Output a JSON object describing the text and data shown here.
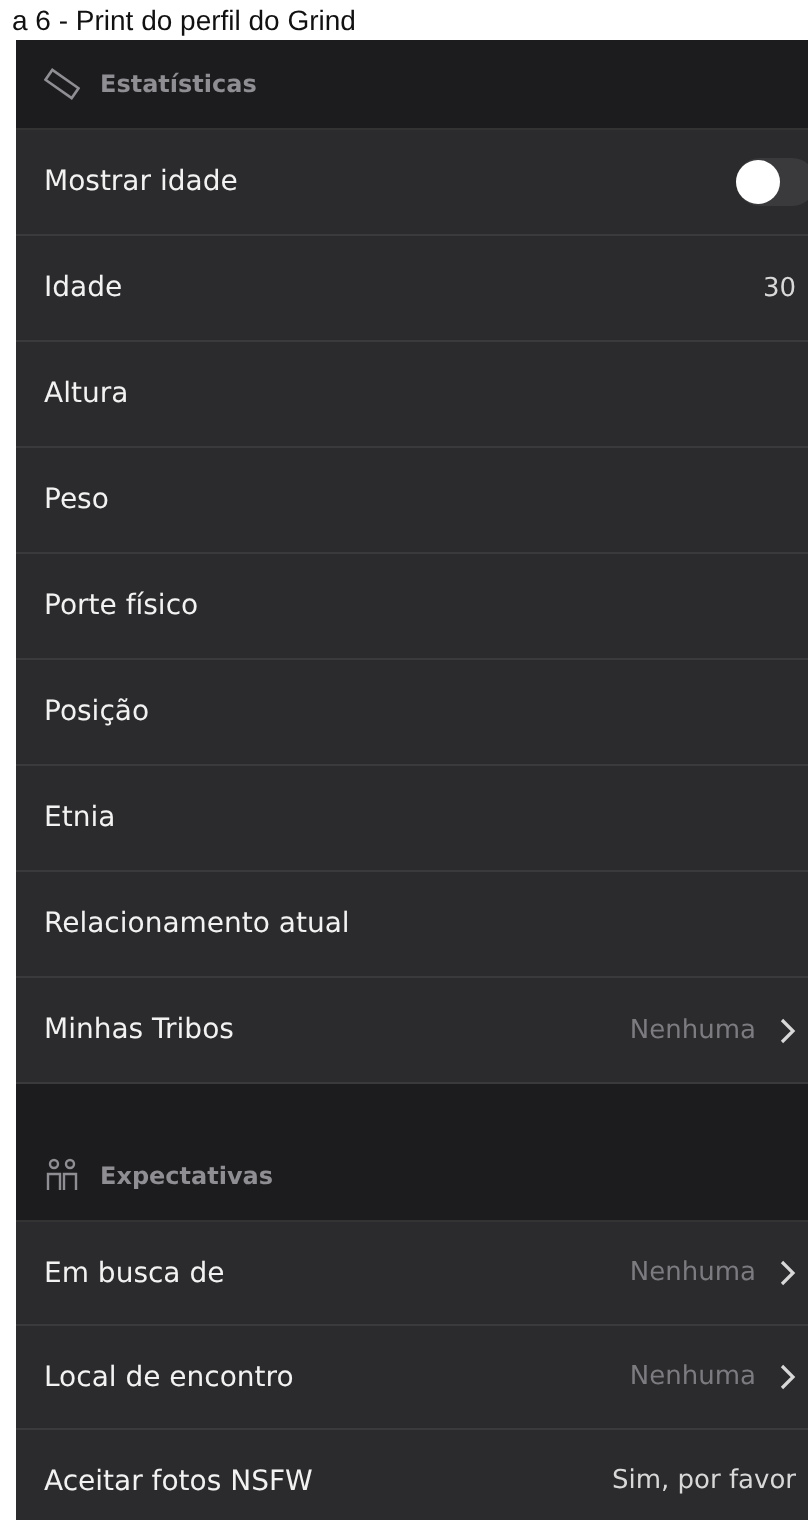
{
  "caption": "a 6 - Print do perfil do Grind",
  "sections": [
    {
      "title": "Estatísticas",
      "rows": [
        {
          "kind": "toggle",
          "label": "Mostrar idade",
          "on": false
        },
        {
          "kind": "value",
          "label": "Idade",
          "value": "30"
        },
        {
          "kind": "value",
          "label": "Altura"
        },
        {
          "kind": "value",
          "label": "Peso"
        },
        {
          "kind": "value",
          "label": "Porte físico"
        },
        {
          "kind": "value",
          "label": "Posição"
        },
        {
          "kind": "value",
          "label": "Etnia"
        },
        {
          "kind": "value",
          "label": "Relacionamento atual"
        },
        {
          "kind": "link",
          "label": "Minhas Tribos",
          "value": "Nenhuma"
        }
      ]
    },
    {
      "title": "Expectativas",
      "rows": [
        {
          "kind": "link",
          "label": "Em busca de",
          "value": "Nenhuma"
        },
        {
          "kind": "link",
          "label": "Local de encontro",
          "value": "Nenhuma"
        },
        {
          "kind": "value",
          "label": "Aceitar fotos NSFW",
          "value": "Sim, por favor"
        }
      ]
    }
  ]
}
